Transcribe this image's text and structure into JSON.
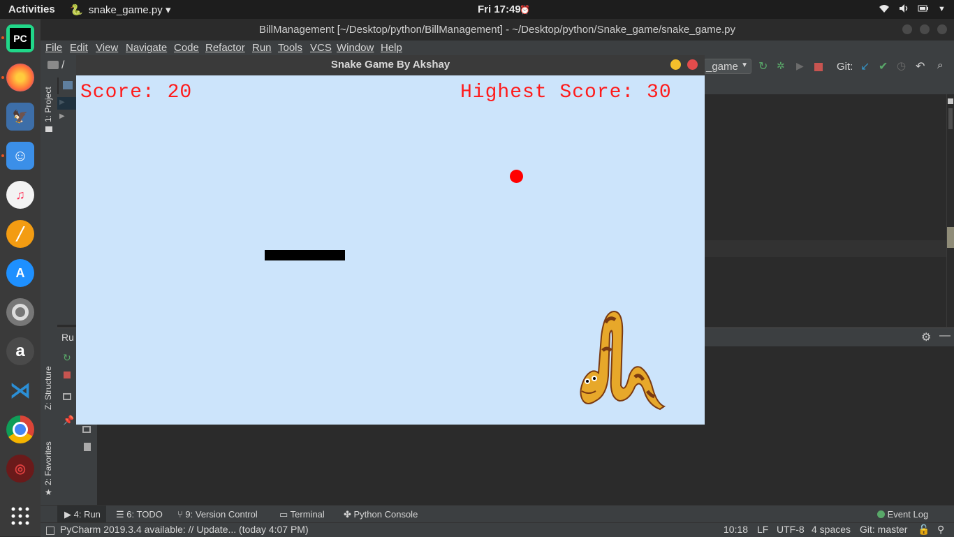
{
  "topbar": {
    "activities": "Activities",
    "app_name": "snake_game.py",
    "clock": "Fri 17:49"
  },
  "ide": {
    "title": "BillManagement [~/Desktop/python/BillManagement] - ~/Desktop/python/Snake_game/snake_game.py",
    "menu": [
      "File",
      "Edit",
      "View",
      "Navigate",
      "Code",
      "Refactor",
      "Run",
      "Tools",
      "VCS",
      "Window",
      "Help"
    ],
    "breadcrumb": "/",
    "run_config": "_game",
    "git_label": "Git:",
    "run_tab_partial": "Ru",
    "side_tabs": {
      "project": "1: Project",
      "structure": "Z: Structure",
      "favorites": "2: Favorites"
    },
    "bottom_tabs": [
      "4: Run",
      "6: TODO",
      "9: Version Control",
      "Terminal",
      "Python Console"
    ],
    "event_log": "Event Log",
    "status_message": "PyCharm 2019.3.4 available: // Update... (today 4:07 PM)",
    "status_right": {
      "position": "10:18",
      "line_sep": "LF",
      "encoding": "UTF-8",
      "indent": "4 spaces",
      "git": "Git: master"
    }
  },
  "game": {
    "window_title": "Snake Game By Akshay",
    "score_text": "Score: 20",
    "high_score_text": "Highest Score: 30",
    "score": 20,
    "high_score": 30,
    "colors": {
      "background": "#cce4fb",
      "text": "#ff1a1a",
      "food": "#ff0000",
      "snake": "#000000"
    }
  }
}
